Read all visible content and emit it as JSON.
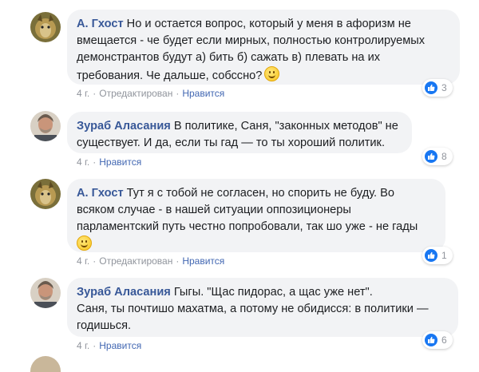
{
  "comments": [
    {
      "author": "А. Гхост",
      "lines": [
        "Но и остается вопрос, который у меня в афоризм не",
        "вмещается - че будет если мирных, полностью контролируемых",
        "демонстрантов будут а) бить б) сажать в) плевать на их",
        "требования. Че дальше, собссно?"
      ],
      "has_emoji": true,
      "time": "4 г.",
      "edited": "Отредактирован",
      "like": "Нравится",
      "reactions": "3"
    },
    {
      "author": "Зураб Аласания",
      "lines": [
        "В политике, Саня, \"законных методов\" не",
        "существует. И да, если ты гад — то ты хороший политик."
      ],
      "has_emoji": false,
      "time": "4 г.",
      "like": "Нравится",
      "reactions": "8"
    },
    {
      "author": "А. Гхост",
      "lines": [
        "Тут я с тобой не согласен, но спорить не буду. Во",
        "всяком случае - в нашей ситуации оппозиционеры",
        "парламентский путь честно попробовали, так шо уже - не гады"
      ],
      "has_emoji": true,
      "time": "4 г.",
      "edited": "Отредактирован",
      "like": "Нравится",
      "reactions": "1"
    },
    {
      "author": "Зураб Аласания",
      "lines": [
        "Гыгы. \"Щас пидорас, а щас уже нет\".",
        "Саня, ты почтишо махатма, а потому не обидисся: в политики —",
        "годишься."
      ],
      "has_emoji": false,
      "time": "4 г.",
      "like": "Нравится",
      "reactions": "6"
    }
  ],
  "colors": {
    "author": "#385898",
    "link": "#4267b2",
    "bubble": "#f2f3f5",
    "like_blue": "#1877f2"
  }
}
